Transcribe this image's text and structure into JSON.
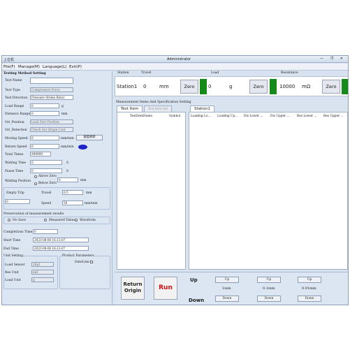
{
  "window": {
    "app_icon_label": "上位机",
    "title": "Administrator",
    "controls": "— ❐ ✕"
  },
  "menu": [
    "File(F)",
    "Manage(M)",
    "Language(L)",
    "Exit(P)"
  ],
  "left": {
    "section_title": "Testing Method Setting",
    "test_name": {
      "label": "Test Name",
      "value": ""
    },
    "test_type": {
      "label": "Test Type",
      "value": "Compressive Force"
    },
    "test_direction": {
      "label": "Test Direction",
      "value": "Pressure Stroke Retur"
    },
    "load_range": {
      "label": "Load Range",
      "value": "0",
      "unit": "g"
    },
    "distance_range": {
      "label": "Distance Range",
      "value": "0",
      "unit": "mm"
    },
    "ori_position": {
      "label": "Ori_Position",
      "value": "Load Zero Position"
    },
    "ori_detection": {
      "label": "Ori_Detection",
      "value": "Check Out Origin Conf"
    },
    "moving_speed": {
      "label": "Moving Speed",
      "value": "0",
      "unit": "mm/min",
      "button": "速度刷新"
    },
    "return_speed": {
      "label": "Return Speed",
      "value": "0",
      "unit": "mm/min"
    },
    "total_times": {
      "label": "Total Times",
      "value": "999999"
    },
    "waiting_time": {
      "label": "Waiting Time",
      "value": "0",
      "unit": "S"
    },
    "pause_time": {
      "label": "Pause Time",
      "value": "0",
      "unit": "S"
    },
    "waiting_position": {
      "label": "Waiting Position",
      "above_zero": "Above Zero",
      "below_zero": "Below Zero",
      "value": "0",
      "unit": "mm"
    },
    "empty_trip": {
      "label": "Empty Trip",
      "value": "0",
      "travel_label": "Travel",
      "travel_value": "0.5",
      "travel_unit": "mm",
      "speed_label": "Speed",
      "speed_value": "50",
      "speed_unit": "mm/min"
    },
    "preservation": {
      "title": "Preservation of measurement results",
      "options": [
        "No Save",
        "Measured Value",
        "Waveform"
      ]
    },
    "completions": {
      "label": "Completions Time",
      "value": "0"
    },
    "start_time": {
      "label": "Start Time",
      "value": "2023-08-06 16:13:07"
    },
    "end_time": {
      "label": "End Time",
      "value": "2023-08-06 16:13:07"
    },
    "unit_setting": {
      "title": "Unit Setting",
      "load_sensor_label": "Load Sensor",
      "load_sensor_value": "2Kgf",
      "res_unit_label": "Res Unit",
      "res_unit_value": "mΩ",
      "load_unit_label": "Load Unit",
      "load_unit_value": "g"
    },
    "product_params": {
      "title": "Product Parameters",
      "dateline_label": "DateLine"
    }
  },
  "stations": {
    "headers": [
      "Station",
      "Travel",
      "Load",
      "Resistance"
    ],
    "name": "Station1",
    "travel": {
      "value": "0",
      "unit": "mm",
      "zero": "Zero"
    },
    "load": {
      "value": "0",
      "unit": "g",
      "zero": "Zero"
    },
    "resistance": {
      "value": "10000",
      "unit": "mΩ",
      "zero": "Zero"
    }
  },
  "measure": {
    "title": "Measurement Items And Specification Setting",
    "tabs": [
      "Test Item",
      "Test Item Set"
    ],
    "left_cols": [
      "TestItemName",
      "Symbol"
    ],
    "station_tab": "Station1",
    "right_cols": [
      "Loading Lo...",
      "Loading Up...",
      "Dis Lower ...",
      "Dis Upper ...",
      "Res Lower ...",
      "Res Upper ..."
    ]
  },
  "controls": {
    "return_origin": "Return Origin",
    "run": "Run",
    "up": "Up",
    "down": "Down",
    "steps": [
      "1mm",
      "0.1mm",
      "0.01mm"
    ],
    "up_btn": "Up",
    "down_btn": "Down",
    "colors": {
      "run_text": "#d01010",
      "station_green": "#138a1a",
      "knob_blue": "#1c22c8"
    }
  }
}
